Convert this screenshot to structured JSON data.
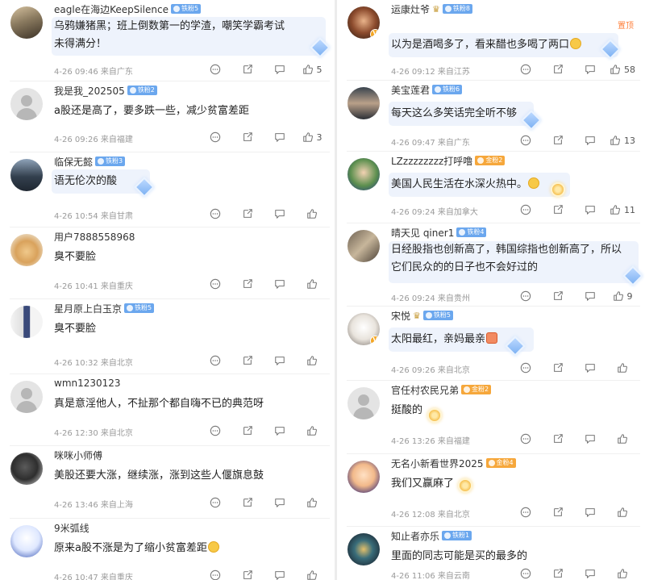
{
  "left": [
    {
      "user": "eagle在海边KeepSilence",
      "badge": "铁粉5",
      "badge_color": "blue",
      "lines": [
        "乌鸦嫌猪黑；班上倒数第一的学渣，嘲笑学霸考试",
        "未得满分！"
      ],
      "date": "4-26 09:46",
      "location": "来自广东",
      "likes": "5",
      "avatar": "silhouette-avatar"
    },
    {
      "user": "我是我_202505",
      "badge": "铁粉2",
      "badge_color": "blue",
      "lines": [
        "a股还是高了，要多跌一些，减少贫富差距"
      ],
      "date": "4-26 09:26",
      "location": "来自福建",
      "likes": "3",
      "avatar": "default-avatar"
    },
    {
      "user": "临保无懿",
      "badge": "铁粉3",
      "badge_color": "blue",
      "lines": [
        "语无伦次的酸"
      ],
      "date": "4-26 10:54",
      "location": "来自甘肃",
      "likes": "",
      "avatar": "dark-portrait-avatar"
    },
    {
      "user": "用户7888558968",
      "badge": "",
      "badge_color": "",
      "lines": [
        "臭不要脸"
      ],
      "date": "4-26 10:41",
      "location": "来自重庆",
      "likes": "",
      "avatar": "bear-avatar"
    },
    {
      "user": "星月原上白玉京",
      "badge": "铁粉5",
      "badge_color": "blue",
      "lines": [
        "臭不要脸"
      ],
      "date": "4-26 10:32",
      "location": "来自北京",
      "likes": "",
      "avatar": "calligraphy-avatar"
    },
    {
      "user": "wmn1230123",
      "badge": "",
      "badge_color": "",
      "lines": [
        "真是意淫他人，不扯那个都自嗨不已的典范呀"
      ],
      "date": "4-26 12:30",
      "location": "来自北京",
      "likes": "",
      "avatar": "default-avatar"
    },
    {
      "user": "咪咪小师傅",
      "badge": "",
      "badge_color": "",
      "lines": [
        "美股还要大涨，继续涨，涨到这些人偃旗息鼓"
      ],
      "date": "4-26 13:46",
      "location": "来自上海",
      "likes": "",
      "avatar": "cat-avatar"
    },
    {
      "user": "9米弧线",
      "badge": "",
      "badge_color": "",
      "lines": [
        "原来a股不涨是为了缩小贫富差距"
      ],
      "date": "4-26 10:47",
      "location": "来自重庆",
      "likes": "",
      "avatar": "anime-avatar"
    }
  ],
  "right": [
    {
      "user": "运康灶爷",
      "badge": "铁粉8",
      "badge_color": "blue",
      "crown": "♛",
      "top_tag": "置顶",
      "lines": [
        "以为是酒喝多了，看来醋也多喝了两口"
      ],
      "date": "4-26 09:12",
      "location": "来自江苏",
      "likes": "58",
      "avatar": "portrait-avatar"
    },
    {
      "user": "美宝莲君",
      "badge": "铁粉6",
      "badge_color": "blue",
      "lines": [
        "每天这么多笑话完全听不够"
      ],
      "date": "4-26 09:47",
      "location": "来自广东",
      "likes": "13",
      "avatar": "photo-avatar"
    },
    {
      "user": "LZzzzzzzzz打呼噜",
      "badge": "金粉2",
      "badge_color": "orange",
      "lines": [
        "美国人民生活在水深火热中。"
      ],
      "date": "4-26 09:24",
      "location": "来自加拿大",
      "likes": "11",
      "avatar": "boy-avatar"
    },
    {
      "user": "晴天见 qiner1",
      "badge": "铁粉4",
      "badge_color": "blue",
      "lines": [
        "日经股指也创新高了，韩国综指也创新高了，所以",
        "它们民众的的日子也不会好过的"
      ],
      "date": "4-26 09:24",
      "location": "来自贵州",
      "likes": "9",
      "avatar": "room-avatar"
    },
    {
      "user": "宋悦",
      "badge": "铁粉5",
      "badge_color": "blue",
      "crown": "♛",
      "lines": [
        "太阳最红，亲妈最亲"
      ],
      "date": "4-26 09:26",
      "location": "来自北京",
      "likes": "",
      "avatar": "dog-avatar"
    },
    {
      "user": "官任村农民兄弟",
      "badge": "金粉2",
      "badge_color": "orange",
      "lines": [
        "挺酸的"
      ],
      "date": "4-26 13:26",
      "location": "来自福建",
      "likes": "",
      "avatar": "default-avatar"
    },
    {
      "user": "无名小新看世界2025",
      "badge": "金粉4",
      "badge_color": "orange",
      "lines": [
        "我们又赢麻了"
      ],
      "date": "4-26 12:08",
      "location": "来自北京",
      "likes": "",
      "avatar": "cartoon-avatar"
    },
    {
      "user": "知止者亦乐",
      "badge": "铁粉1",
      "badge_color": "blue",
      "lines": [
        "里面的同志可能是买的最多的"
      ],
      "date": "4-26 11:06",
      "location": "来自云南",
      "likes": "",
      "avatar": "road-avatar"
    }
  ],
  "icons": {
    "more": "more-icon",
    "reply": "reply-icon",
    "comment": "comment-icon",
    "like": "like-icon"
  },
  "colors": {
    "badge_blue": "#6ba7ee",
    "badge_orange": "#f6a73b",
    "meta_gray": "#9a9a9a",
    "top_tag": "#ff7f3a"
  }
}
